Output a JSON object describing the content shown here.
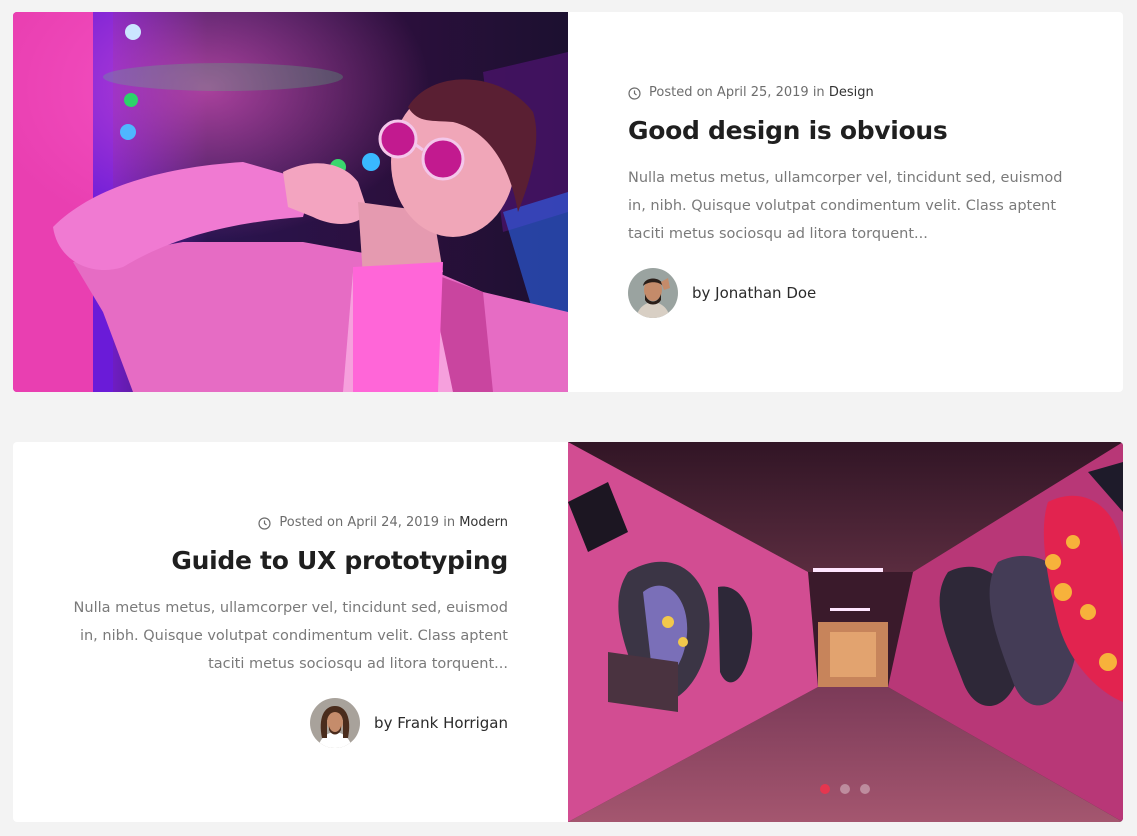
{
  "posts": [
    {
      "posted_on": "Posted on",
      "date": "April 25, 2019",
      "in": "in",
      "category": "Design",
      "title": "Good design is obvious",
      "excerpt": "Nulla metus metus, ullamcorper vel, tincidunt sed, euismod in, nibh. Quisque volutpat condimentum velit. Class aptent taciti metus sociosqu ad litora torquent...",
      "author": "by Jonathan Doe"
    },
    {
      "posted_on": "Posted on",
      "date": "April 24, 2019",
      "in": "in",
      "category": "Modern",
      "title": "Guide to UX prototyping",
      "excerpt": "Nulla metus metus, ullamcorper vel, tincidunt sed, euismod in, nibh. Quisque volutpat condimentum velit. Class aptent taciti metus sociosqu ad litora torquent...",
      "author": "by Frank Horrigan"
    }
  ],
  "carousel": {
    "slides": 3,
    "active": 0
  },
  "colors": {
    "accent": "#e5364f",
    "background": "#f3f3f3"
  },
  "icons": {
    "meta": "clock-icon"
  }
}
